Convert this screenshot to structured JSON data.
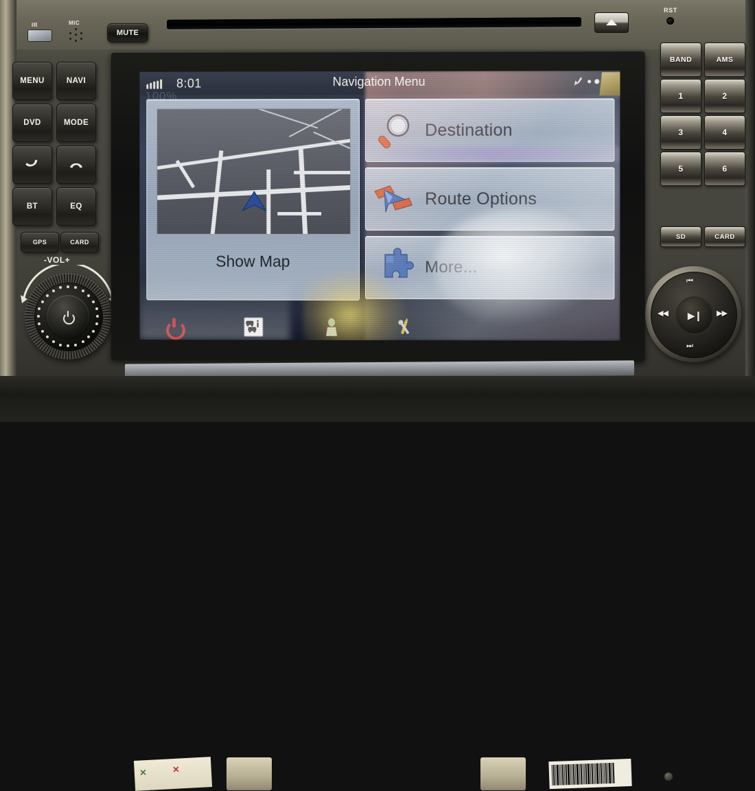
{
  "device": {
    "top_panel": {
      "ir_label": "IR",
      "mic_label": "MIC",
      "mute_label": "MUTE",
      "reset_label": "RST",
      "eject_icon": "eject-icon",
      "disc_slot": "disc-slot"
    },
    "left_buttons": [
      {
        "label": "MENU",
        "name": "menu-button"
      },
      {
        "label": "NAVI",
        "name": "navi-button"
      },
      {
        "label": "DVD",
        "name": "dvd-button"
      },
      {
        "label": "MODE",
        "name": "mode-button"
      },
      {
        "label": "",
        "name": "call-answer-button",
        "icon": "phone-answer-icon"
      },
      {
        "label": "",
        "name": "call-end-button",
        "icon": "phone-hangup-icon"
      },
      {
        "label": "BT",
        "name": "bluetooth-button"
      },
      {
        "label": "EQ",
        "name": "equalizer-button"
      },
      {
        "label": "GPS",
        "name": "gps-button"
      },
      {
        "label": "CARD",
        "name": "card-button"
      }
    ],
    "volume": {
      "label": "-VOL+",
      "knob_icon": "power-icon"
    },
    "right_buttons": [
      {
        "label": "BAND",
        "name": "band-button"
      },
      {
        "label": "AMS",
        "name": "ams-button"
      },
      {
        "label": "1",
        "name": "preset-1-button"
      },
      {
        "label": "2",
        "name": "preset-2-button"
      },
      {
        "label": "3",
        "name": "preset-3-button"
      },
      {
        "label": "4",
        "name": "preset-4-button"
      },
      {
        "label": "5",
        "name": "preset-5-button"
      },
      {
        "label": "6",
        "name": "preset-6-button"
      },
      {
        "label": "SD",
        "name": "sd-button"
      },
      {
        "label": "CARD",
        "name": "card-slot-button"
      }
    ],
    "dpad": {
      "up": "⏮",
      "left": "◀◀",
      "center": "▶❙",
      "right": "▶▶",
      "down": "⏭"
    }
  },
  "screen": {
    "status_bar": {
      "signal_name": "signal-strength-icon",
      "signal_bars": 5,
      "time": "8:01",
      "title": "Navigation Menu",
      "gps_icon": "satellite-dish-icon",
      "gps_dots": 3
    },
    "ghost_text": "100%",
    "tiles": {
      "map": {
        "label": "Show Map",
        "thumb_icon": "map-thumbnail",
        "position_arrow": "navigation-arrow-icon"
      },
      "destination": {
        "label": "Destination",
        "icon": "magnifier-icon"
      },
      "route_options": {
        "label": "Route Options",
        "icon": "route-arrow-icon"
      },
      "more": {
        "label": "More...",
        "icon": "puzzle-piece-icon"
      }
    },
    "taskbar": [
      {
        "name": "power-icon",
        "label": "power-icon"
      },
      {
        "name": "traffic-info-icon",
        "label": "traffic-info-icon"
      },
      {
        "name": "poi-icon",
        "label": "poi-icon"
      },
      {
        "name": "tools-settings-icon",
        "label": "tools-settings-icon"
      }
    ]
  },
  "colors": {
    "screen_bg": "#2e3647",
    "tile_bg": "#c4d0de",
    "tile_text": "#252a33",
    "status_bar": "#39404f",
    "power_red": "#c0272d",
    "nav_arrow_blue": "#2b4f9e",
    "route_orange": "#d2502a",
    "puzzle_blue": "#4a6fb5",
    "bezel": "#161614",
    "dash": "#4b4a41"
  }
}
